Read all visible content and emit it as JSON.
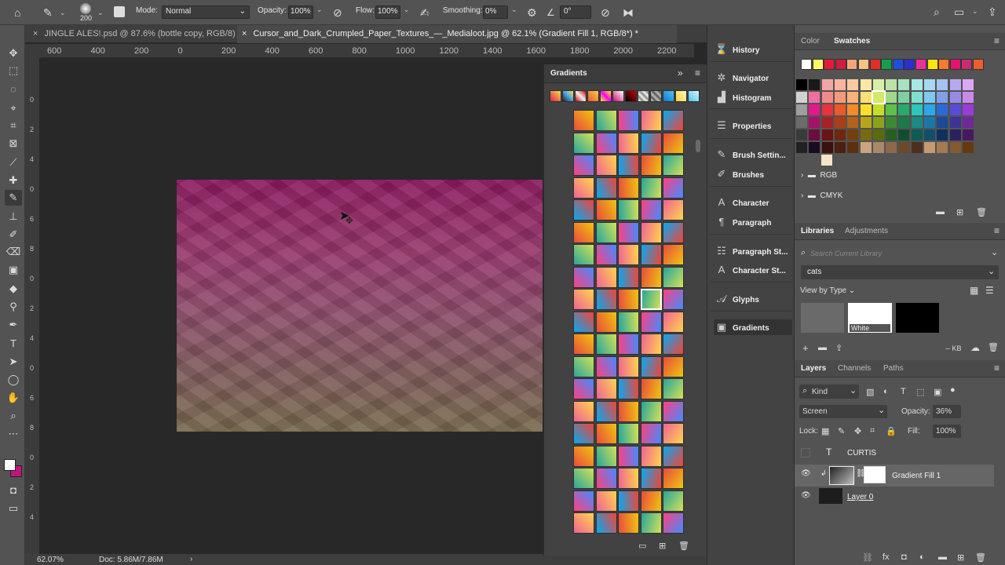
{
  "options_bar": {
    "brush_size": "200",
    "mode_label": "Mode:",
    "mode_value": "Normal",
    "opacity_label": "Opacity:",
    "opacity_value": "100%",
    "flow_label": "Flow:",
    "flow_value": "100%",
    "smoothing_label": "Smoothing:",
    "smoothing_value": "0%",
    "angle_value": "0°"
  },
  "tabs": [
    {
      "label": "JINGLE ALES!.psd @ 87.6% (bottle copy, RGB/8)"
    },
    {
      "label": "Cursor_and_Dark_Crumpled_Paper_Textures_—_Medialoot.jpg @ 62.1% (Gradient Fill 1, RGB/8*) *"
    }
  ],
  "ruler_top": [
    "600",
    "400",
    "200",
    "0",
    "200",
    "400",
    "600",
    "800",
    "1000",
    "1200",
    "1400",
    "1600",
    "1800",
    "2000",
    "2200"
  ],
  "ruler_left": [
    "0",
    "2",
    "4",
    "0",
    "6",
    "8",
    "0",
    "2",
    "4",
    "0",
    "6",
    "8",
    "0",
    "2",
    "4"
  ],
  "status": {
    "zoom": "62.07%",
    "doc": "Doc: 5.86M/7.86M"
  },
  "gradients_panel": {
    "title": "Gradients"
  },
  "icon_column": [
    {
      "label": "History",
      "icon": "history-icon",
      "glyph": "⌛"
    },
    {
      "label": "Navigator",
      "icon": "navigator-icon",
      "glyph": "✲"
    },
    {
      "label": "Histogram",
      "icon": "histogram-icon",
      "glyph": "▟"
    },
    {
      "label": "Properties",
      "icon": "properties-icon",
      "glyph": "☰"
    },
    {
      "label": "Brush Settin...",
      "icon": "brush-settings-icon",
      "glyph": "✎"
    },
    {
      "label": "Brushes",
      "icon": "brushes-icon",
      "glyph": "✐"
    },
    {
      "label": "Character",
      "icon": "character-icon",
      "glyph": "A"
    },
    {
      "label": "Paragraph",
      "icon": "paragraph-icon",
      "glyph": "¶"
    },
    {
      "label": "Paragraph St...",
      "icon": "paragraph-styles-icon",
      "glyph": "☷"
    },
    {
      "label": "Character St...",
      "icon": "character-styles-icon",
      "glyph": "A"
    },
    {
      "label": "Glyphs",
      "icon": "glyphs-icon",
      "glyph": "𝒜"
    },
    {
      "label": "Gradients",
      "icon": "gradients-icon",
      "glyph": "▣"
    }
  ],
  "swatches_panel": {
    "tabs": [
      "Color",
      "Swatches"
    ],
    "groups": [
      "RGB",
      "CMYK"
    ]
  },
  "libraries_panel": {
    "tabs": [
      "Libraries",
      "Adjustments"
    ],
    "search_placeholder": "Search Current Library",
    "library": "cats",
    "view_by": "View by Type",
    "item_label": "White",
    "size_label": "-- KB"
  },
  "layers_panel": {
    "tabs": [
      "Layers",
      "Channels",
      "Paths"
    ],
    "kind": "Kind",
    "blend_mode": "Screen",
    "opacity_label": "Opacity:",
    "opacity_value": "36%",
    "lock_label": "Lock:",
    "fill_label": "Fill:",
    "fill_value": "100%",
    "layers": [
      {
        "name": "CURTIS"
      },
      {
        "name": "Gradient Fill 1"
      },
      {
        "name": "Layer 0"
      }
    ]
  },
  "colors": {
    "accent_fg": "#ffffff",
    "accent_bg": "#c0157d",
    "selected_layer": "#666666"
  }
}
